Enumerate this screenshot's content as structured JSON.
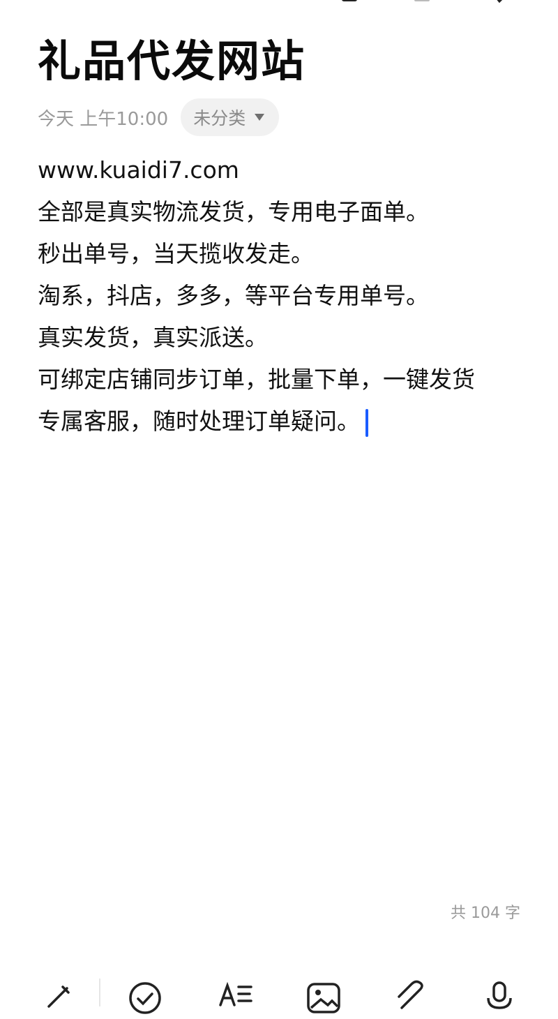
{
  "note": {
    "title": "礼品代发网站",
    "date": "今天 上午10:00",
    "category": "未分类",
    "lines": [
      "www.kuaidi7.com",
      "全部是真实物流发货，专用电子面单。",
      "秒出单号，当天揽收发走。",
      "淘系，抖店，多多，等平台专用单号。",
      "真实发货，真实派送。",
      "可绑定店铺同步订单，批量下单，一键发货",
      "专属客服，随时处理订单疑问。"
    ],
    "char_count": "共 104 字"
  },
  "toolbar": {
    "icons": [
      "pencil-icon",
      "checklist-icon",
      "text-format-icon",
      "image-icon",
      "attachment-icon",
      "microphone-icon"
    ]
  },
  "colors": {
    "accent": "#1a5cff",
    "muted": "#9a9a9a",
    "chip_bg": "#f1f1f1"
  }
}
